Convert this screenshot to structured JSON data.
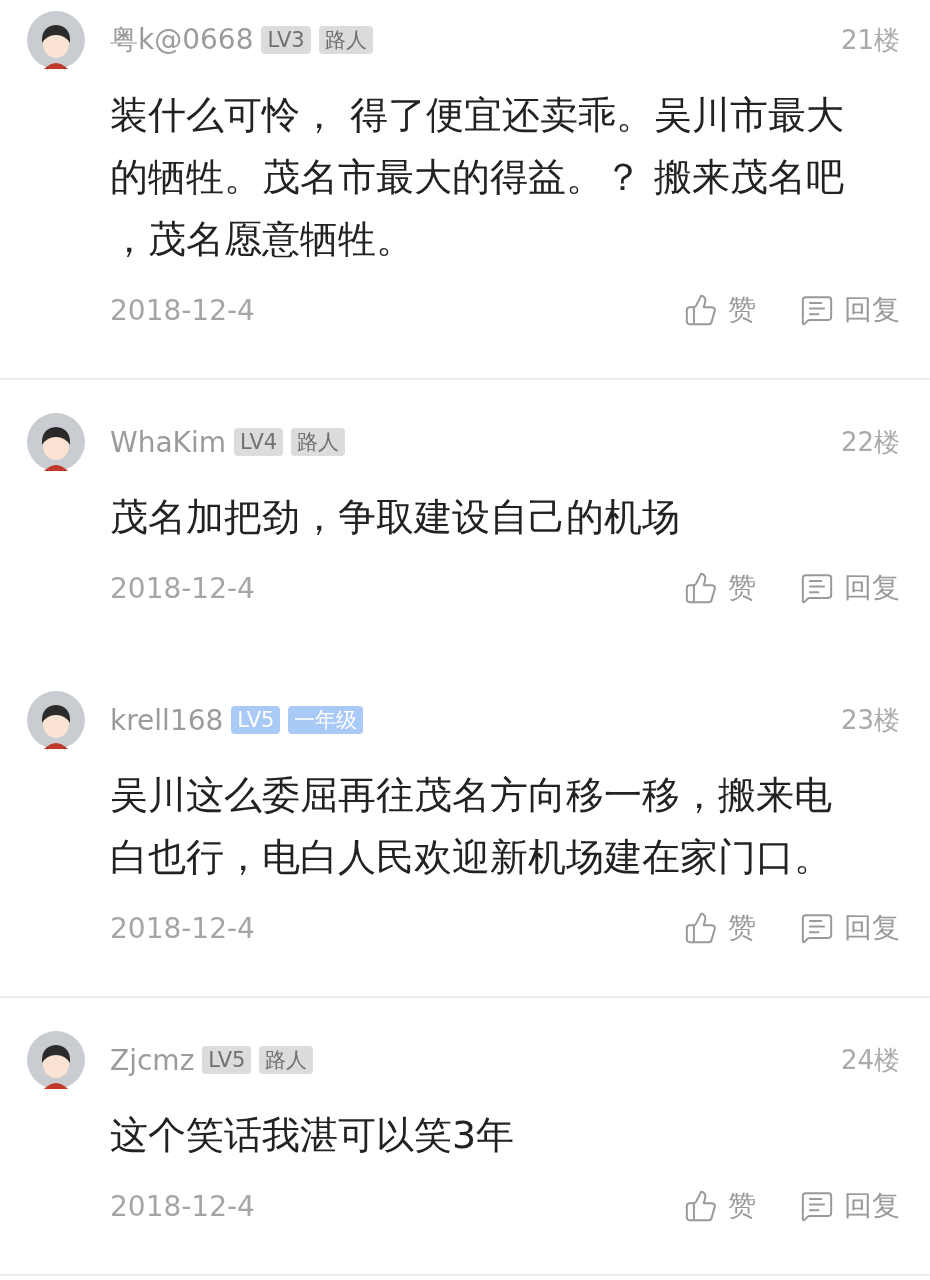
{
  "comments": [
    {
      "username": "粤k@0668",
      "badges": [
        {
          "text": "LV3",
          "color": "#dcdcdc"
        },
        {
          "text": "路人",
          "color": "#dcdcdc"
        }
      ],
      "floor": "21楼",
      "content": "装什么可怜， 得了便宜还卖乖。吴川市最大的牺牲。茂名市最大的得益。？ 搬来茂名吧，茂名愿意牺牲。",
      "date": "2018-12-4",
      "actions": [
        {
          "kind": "like",
          "label": "赞"
        },
        {
          "kind": "reply",
          "label": "回复"
        }
      ],
      "divider": true
    },
    {
      "username": "WhaKim",
      "badges": [
        {
          "text": "LV4",
          "color": "#dcdcdc"
        },
        {
          "text": "路人",
          "color": "#dcdcdc"
        }
      ],
      "floor": "22楼",
      "content": "茂名加把劲，争取建设自己的机场",
      "date": "2018-12-4",
      "actions": [
        {
          "kind": "like",
          "label": "赞"
        },
        {
          "kind": "reply",
          "label": "回复"
        }
      ],
      "divider": false
    },
    {
      "username": "krell168",
      "badges": [
        {
          "text": "LV5",
          "color": "#a9c9f6"
        },
        {
          "text": "一年级",
          "color": "#a9c9f6"
        }
      ],
      "floor": "23楼",
      "content": "吴川这么委屈再往茂名方向移一移，搬来电白也行，电白人民欢迎新机场建在家门口。",
      "date": "2018-12-4",
      "actions": [
        {
          "kind": "like",
          "label": "赞"
        },
        {
          "kind": "reply",
          "label": "回复"
        }
      ],
      "divider": true
    },
    {
      "username": "Zjcmz",
      "badges": [
        {
          "text": "LV5",
          "color": "#dcdcdc"
        },
        {
          "text": "路人",
          "color": "#dcdcdc"
        }
      ],
      "floor": "24楼",
      "content": "这个笑话我湛可以笑3年",
      "date": "2018-12-4",
      "actions": [
        {
          "kind": "like",
          "label": "赞"
        },
        {
          "kind": "reply",
          "label": "回复"
        }
      ],
      "divider": true
    }
  ]
}
